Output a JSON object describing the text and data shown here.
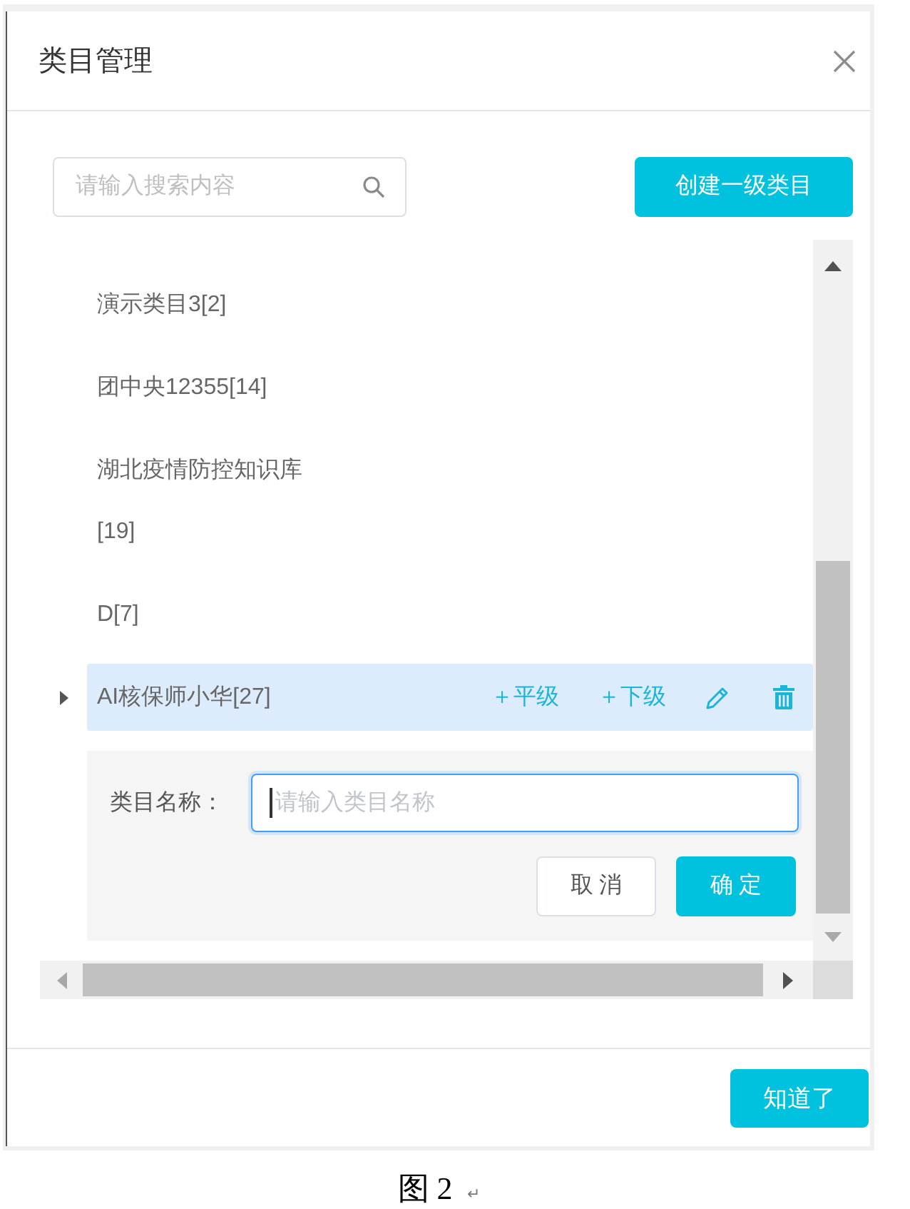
{
  "dialog": {
    "title": "类目管理"
  },
  "toolbar": {
    "search": {
      "placeholder": "请输入搜索内容"
    },
    "create_button": "创建一级类目"
  },
  "tree": {
    "items": [
      {
        "label": "演示类目3[2]",
        "selected": false,
        "expandable": false
      },
      {
        "label": "团中央12355[14]",
        "selected": false,
        "expandable": false
      },
      {
        "label": "湖北疫情防控知识库[19]",
        "selected": false,
        "expandable": false
      },
      {
        "label": "D[7]",
        "selected": false,
        "expandable": false
      },
      {
        "label": "AI核保师小华[27]",
        "selected": true,
        "expandable": true,
        "expanded": false,
        "actions": [
          {
            "kind": "add",
            "label": "＋平级"
          },
          {
            "kind": "add",
            "label": "＋下级"
          },
          {
            "kind": "edit"
          },
          {
            "kind": "delete"
          }
        ]
      }
    ]
  },
  "edit_form": {
    "label": "类目名称：",
    "input": {
      "placeholder": "请输入类目名称",
      "focused": true
    },
    "buttons": [
      {
        "label": "取 消",
        "primary": false
      },
      {
        "label": "确 定",
        "primary": true
      }
    ]
  },
  "footer": {
    "button": "知道了"
  },
  "caption": {
    "text": "图 2",
    "mark": "↵"
  }
}
